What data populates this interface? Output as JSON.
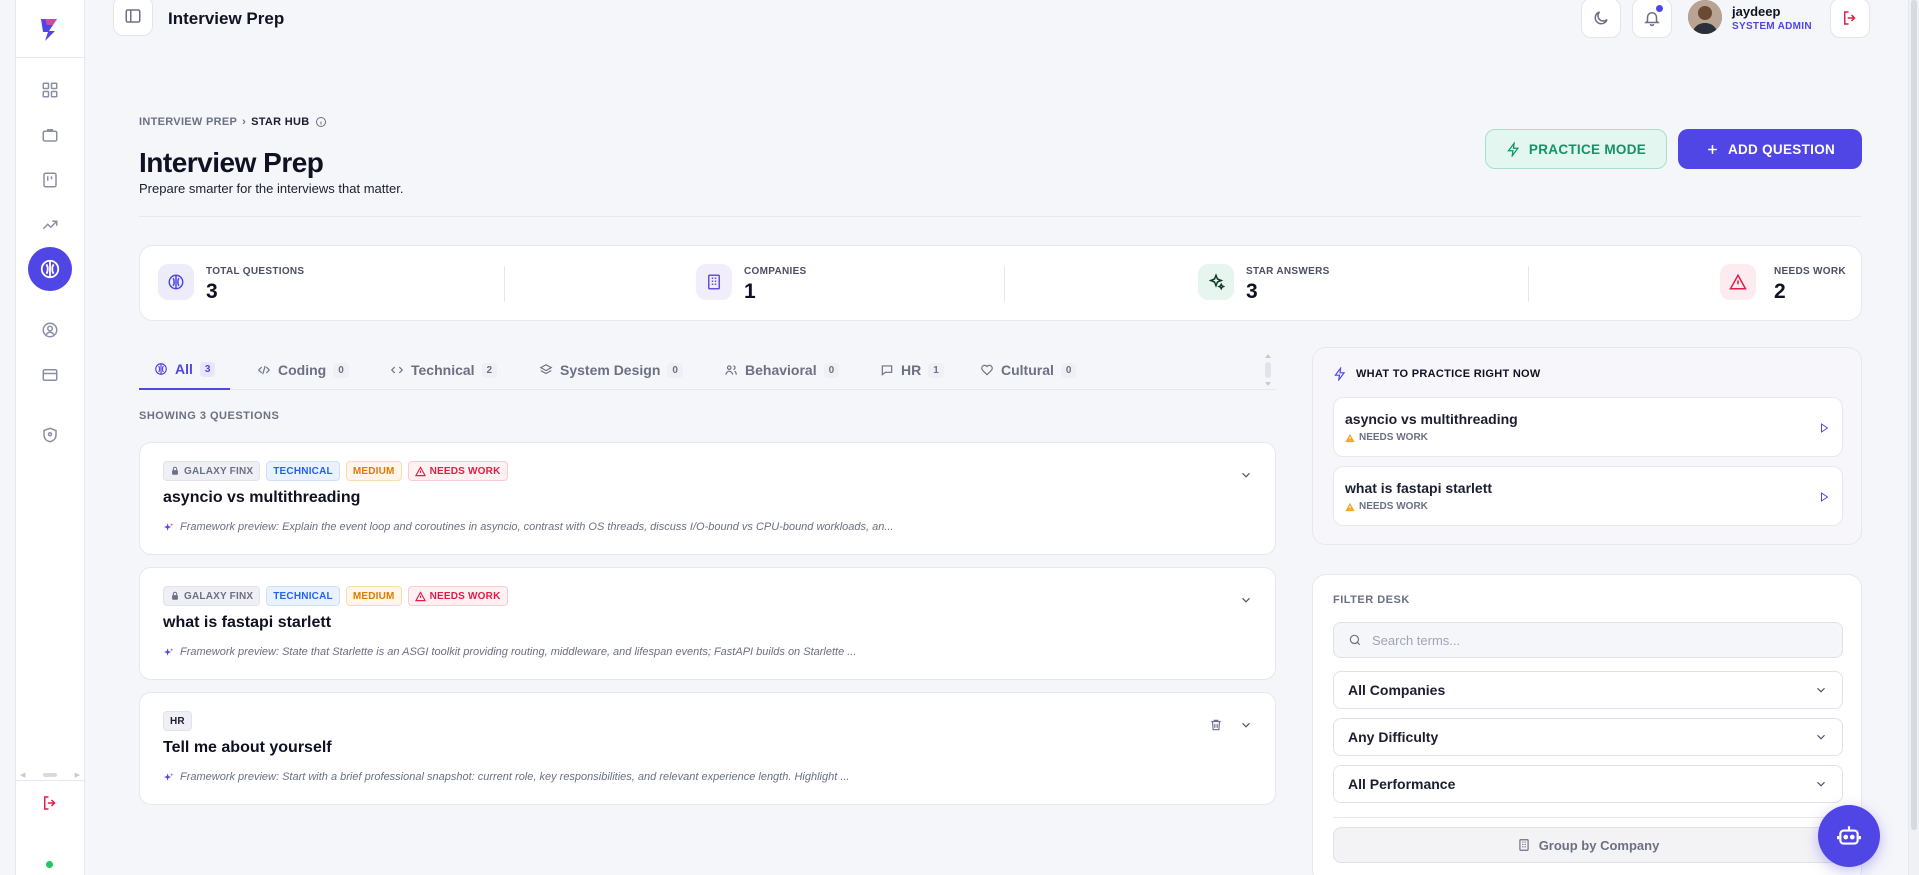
{
  "colors": {
    "accent": "#4f46e5",
    "success": "#129466",
    "danger": "#e11d48",
    "warning": "#e07b00",
    "info": "#2563eb"
  },
  "topbar": {
    "page_title": "Interview Prep",
    "user": {
      "name": "jaydeep",
      "role": "SYSTEM ADMIN"
    }
  },
  "sidebar": {
    "items": [
      {
        "icon": "dashboard-icon"
      },
      {
        "icon": "briefcase-icon"
      },
      {
        "icon": "kanban-icon"
      },
      {
        "icon": "trending-icon"
      },
      {
        "icon": "brain-icon",
        "active": true
      },
      {
        "icon": "user-circle-icon"
      },
      {
        "icon": "credit-card-icon"
      },
      {
        "icon": "shield-icon"
      }
    ]
  },
  "breadcrumb": {
    "parent": "INTERVIEW PREP",
    "sep": "›",
    "current": "STAR HUB"
  },
  "header": {
    "title": "Interview Prep",
    "subtitle": "Prepare smarter for the interviews that matter.",
    "practice_label": "PRACTICE MODE",
    "add_label": "ADD QUESTION"
  },
  "stats": [
    {
      "label": "TOTAL QUESTIONS",
      "value": "3"
    },
    {
      "label": "COMPANIES",
      "value": "1"
    },
    {
      "label": "STAR ANSWERS",
      "value": "3"
    },
    {
      "label": "NEEDS WORK",
      "value": "2"
    }
  ],
  "tabs": [
    {
      "label": "All",
      "count": "3"
    },
    {
      "label": "Coding",
      "count": "0"
    },
    {
      "label": "Technical",
      "count": "2"
    },
    {
      "label": "System Design",
      "count": "0"
    },
    {
      "label": "Behavioral",
      "count": "0"
    },
    {
      "label": "HR",
      "count": "1"
    },
    {
      "label": "Cultural",
      "count": "0"
    }
  ],
  "showing": "SHOWING 3 QUESTIONS",
  "questions": [
    {
      "company": "GALAXY FINX",
      "type": "TECHNICAL",
      "difficulty": "MEDIUM",
      "status": "NEEDS WORK",
      "title": "asyncio vs multithreading",
      "preview": "Framework preview: Explain the event loop and coroutines in asyncio, contrast with OS threads, discuss I/O-bound vs CPU-bound workloads, an..."
    },
    {
      "company": "GALAXY FINX",
      "type": "TECHNICAL",
      "difficulty": "MEDIUM",
      "status": "NEEDS WORK",
      "title": "what is fastapi starlett",
      "preview": "Framework preview: State that Starlette is an ASGI toolkit providing routing, middleware, and lifespan events; FastAPI builds on Starlette ..."
    },
    {
      "type": "HR",
      "title": "Tell me about yourself",
      "preview": "Framework preview: Start with a brief professional snapshot: current role, key responsibilities, and relevant experience length. Highlight ..."
    }
  ],
  "practice_panel": {
    "title": "WHAT TO PRACTICE RIGHT NOW",
    "items": [
      {
        "title": "asyncio vs multithreading",
        "status": "NEEDS WORK"
      },
      {
        "title": "what is fastapi starlett",
        "status": "NEEDS WORK"
      }
    ]
  },
  "filter": {
    "title": "FILTER DESK",
    "search_placeholder": "Search terms...",
    "company": "All Companies",
    "difficulty": "Any Difficulty",
    "performance": "All Performance",
    "group_label": "Group by Company"
  }
}
